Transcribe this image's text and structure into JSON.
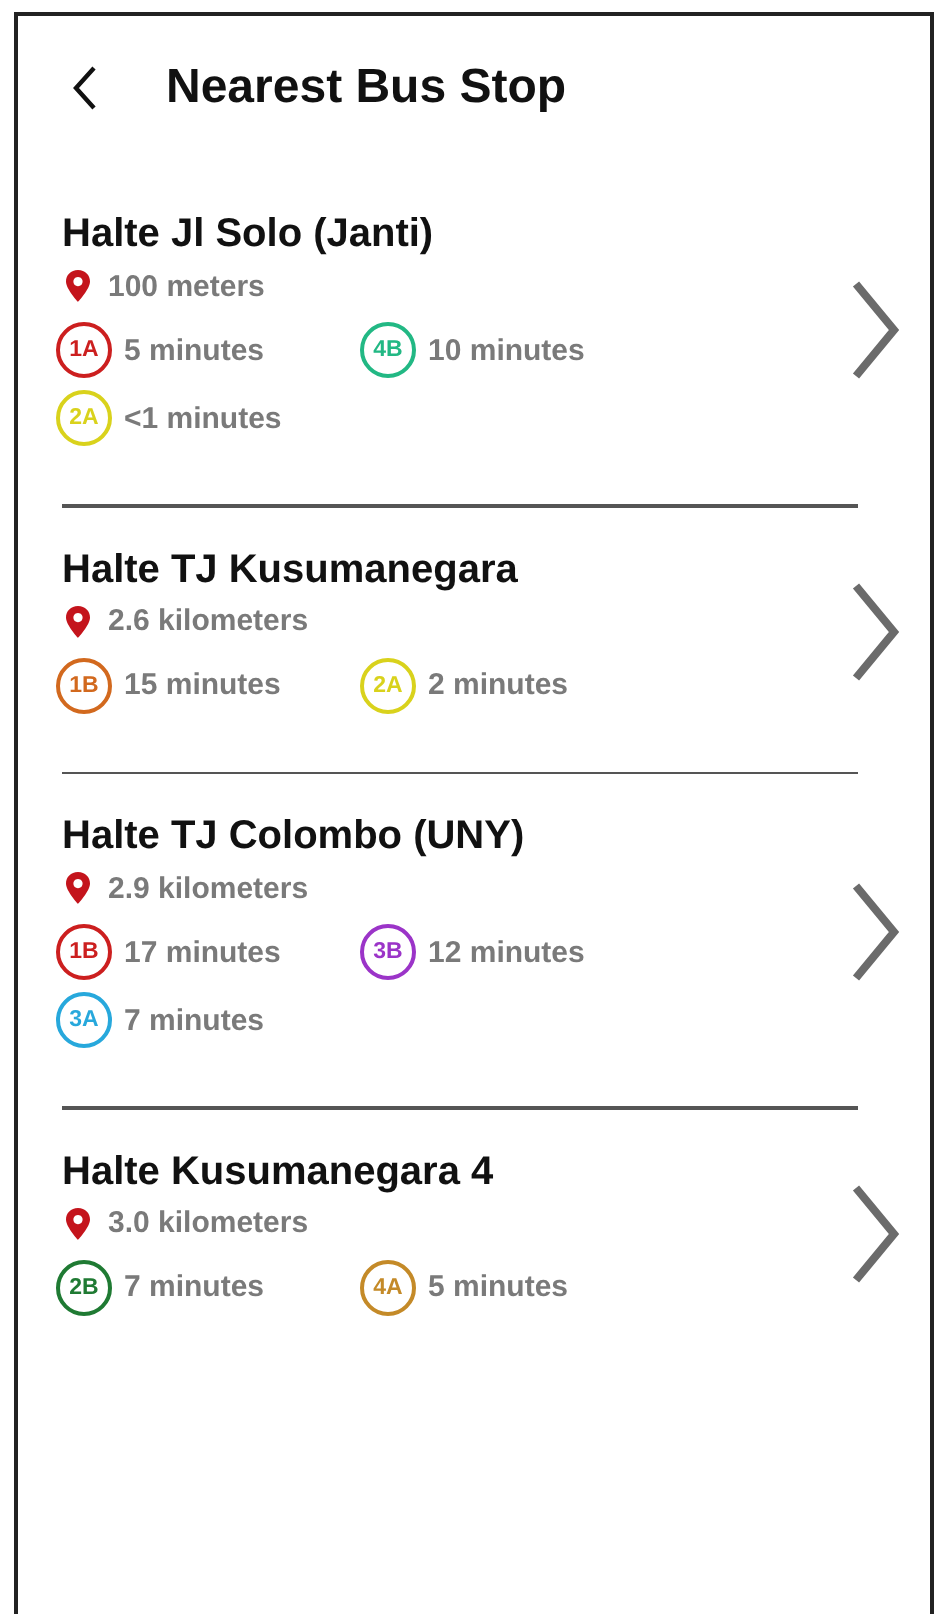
{
  "header": {
    "title": "Nearest Bus Stop"
  },
  "stops": [
    {
      "name": "Halte Jl Solo (Janti)",
      "distance": "100 meters",
      "routes": [
        {
          "code": "1A",
          "color": "#cc1f1f",
          "eta": "5 minutes"
        },
        {
          "code": "4B",
          "color": "#22b884",
          "eta": "10 minutes"
        },
        {
          "code": "2A",
          "color": "#d9d21c",
          "eta": "<1 minutes"
        }
      ]
    },
    {
      "name": "Halte TJ Kusumanegara",
      "distance": "2.6 kilometers",
      "routes": [
        {
          "code": "1B",
          "color": "#d2691e",
          "eta": "15 minutes"
        },
        {
          "code": "2A",
          "color": "#d9d21c",
          "eta": "2 minutes"
        }
      ]
    },
    {
      "name": "Halte TJ Colombo (UNY)",
      "distance": "2.9 kilometers",
      "routes": [
        {
          "code": "1B",
          "color": "#cc1f1f",
          "eta": "17 minutes"
        },
        {
          "code": "3B",
          "color": "#9b34c8",
          "eta": "12 minutes"
        },
        {
          "code": "3A",
          "color": "#27a8dc",
          "eta": "7 minutes"
        }
      ]
    },
    {
      "name": "Halte Kusumanegara 4",
      "distance": "3.0 kilometers",
      "routes": [
        {
          "code": "2B",
          "color": "#1f7a33",
          "eta": "7 minutes"
        },
        {
          "code": "4A",
          "color": "#c48a28",
          "eta": "5 minutes"
        }
      ]
    }
  ]
}
